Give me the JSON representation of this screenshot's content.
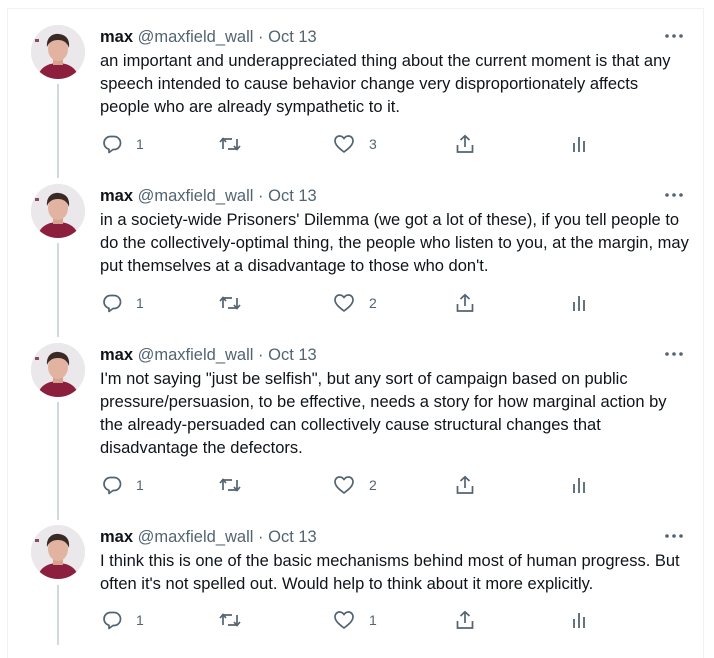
{
  "tweets": [
    {
      "name": "max",
      "handle": "@maxfield_wall",
      "separator": "·",
      "date": "Oct 13",
      "text": "an important and underappreciated thing about the current moment is that any speech intended to cause behavior change very disproportionately affects people who are already sympathetic to it.",
      "replies": "1",
      "retweets": "",
      "likes": "3"
    },
    {
      "name": "max",
      "handle": "@maxfield_wall",
      "separator": "·",
      "date": "Oct 13",
      "text": "in a society-wide Prisoners' Dilemma (we got a lot of these), if you tell people to do the collectively-optimal thing, the people who listen to you, at the margin, may put themselves at a disadvantage to those who don't.",
      "replies": "1",
      "retweets": "",
      "likes": "2"
    },
    {
      "name": "max",
      "handle": "@maxfield_wall",
      "separator": "·",
      "date": "Oct 13",
      "text": "I'm not saying \"just be selfish\", but any sort of campaign based on public pressure/persuasion, to be effective, needs a story for how marginal action by the already-persuaded can collectively cause structural changes that disadvantage the defectors.",
      "replies": "1",
      "retweets": "",
      "likes": "2"
    },
    {
      "name": "max",
      "handle": "@maxfield_wall",
      "separator": "·",
      "date": "Oct 13",
      "text": "I think this is one of the basic mechanisms behind most of human progress. But often it's not spelled out. Would help to think about it more explicitly.",
      "replies": "1",
      "retweets": "",
      "likes": "1"
    }
  ],
  "icons": {
    "reply": "reply-icon",
    "retweet": "retweet-icon",
    "like": "heart-icon",
    "share": "share-icon",
    "analytics": "analytics-icon",
    "more": "more-icon"
  },
  "colors": {
    "text": "#0f1419",
    "secondary": "#536471",
    "thread_line": "#cfd9de"
  }
}
